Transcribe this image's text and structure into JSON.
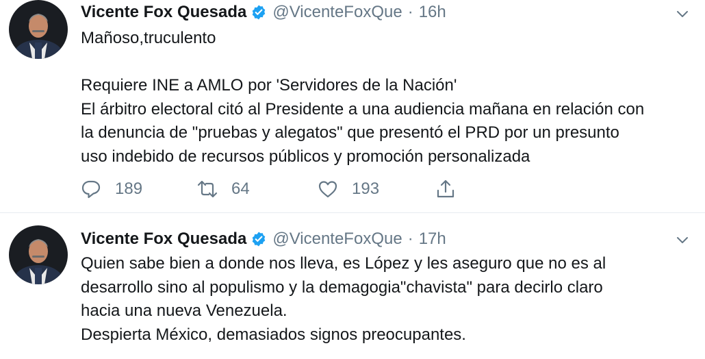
{
  "tweets": [
    {
      "name": "Vicente Fox Quesada",
      "handle": "@VicenteFoxQue",
      "separator": "·",
      "time": "16h",
      "lines": [
        "Mañoso,truculento",
        "",
        "Requiere INE a AMLO por 'Servidores de la Nación'",
        "El árbitro electoral citó al Presidente a una audiencia mañana en relación con",
        "la denuncia de \"pruebas y alegatos\" que presentó el PRD por un presunto",
        "uso indebido de recursos públicos y promoción personalizada"
      ],
      "replies": "189",
      "retweets": "64",
      "likes": "193"
    },
    {
      "name": "Vicente Fox Quesada",
      "handle": "@VicenteFoxQue",
      "separator": "·",
      "time": "17h",
      "lines": [
        "Quien sabe bien a donde nos lleva, es López y les aseguro que no es al",
        "desarrollo sino al populismo y la demagogia\"chavista\" para decirlo claro",
        "hacia una nueva Venezuela.",
        "Despierta México, demasiados signos preocupantes."
      ]
    }
  ],
  "colors": {
    "text": "#14171a",
    "muted": "#657786",
    "verified": "#1da1f2",
    "divider": "#e6ecf0"
  },
  "icons": [
    "avatar",
    "verified-badge-icon",
    "chevron-down-icon",
    "reply-icon",
    "retweet-icon",
    "like-icon",
    "share-icon"
  ]
}
